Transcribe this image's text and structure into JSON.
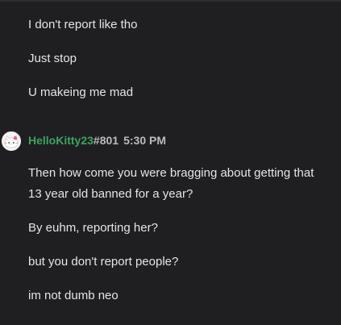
{
  "previous_messages": [
    "I don't report like tho",
    "Just stop",
    "U makeing me mad"
  ],
  "group": {
    "username": "HelloKitty23",
    "tag": "#801",
    "timestamp": "5:30 PM",
    "avatar_icon": "hello-kitty-avatar-icon",
    "username_color": "#3ba55d",
    "messages": [
      "Then how come you were bragging about getting that",
      "13 year old banned for a year?",
      "By euhm, reporting her?",
      "but you don't report people?",
      "im not dumb neo"
    ]
  }
}
